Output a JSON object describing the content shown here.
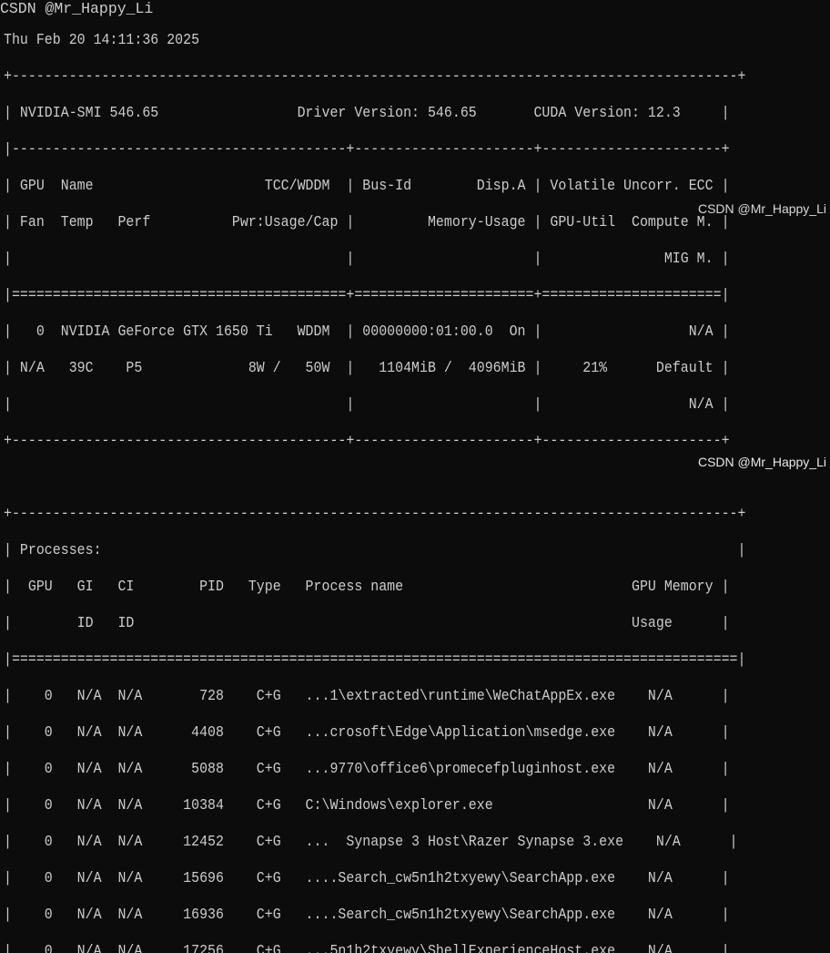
{
  "terminal": {
    "lines": [
      "",
      "Thu Feb 20 14:11:36 2025",
      "+-----------------------------------------------------------------------------------------+",
      "| NVIDIA-SMI 546.65                 Driver Version: 546.65       CUDA Version: 12.3     |",
      "|-----------------------------------------+----------------------+----------------------+",
      "| GPU  Name                     TCC/WDDM  | Bus-Id        Disp.A | Volatile Uncorr. ECC |",
      "| Fan  Temp   Perf          Pwr:Usage/Cap |         Memory-Usage | GPU-Util  Compute M. |",
      "|                                         |                      |               MIG M. |",
      "|=========================================+======================+======================|",
      "|   0  NVIDIA GeForce GTX 1650 Ti   WDDM  | 00000000:01:00.0  On |                  N/A |",
      "| N/A   39C    P5             8W /   50W  |   1104MiB /  4096MiB |     21%      Default |",
      "|                                         |                      |                  N/A |",
      "+-----------------------------------------+----------------------+----------------------+",
      "",
      "+-----------------------------------------------------------------------------------------+",
      "| Processes:                                                                              |",
      "|  GPU   GI   CI        PID   Type   Process name                            GPU Memory |",
      "|        ID   ID                                                             Usage      |",
      "|=========================================================================================|",
      "|    0   N/A  N/A       728    C+G   ...1\\extracted\\runtime\\WeChatAppEx.exe    N/A      |",
      "|    0   N/A  N/A      4408    C+G   ...crosoft\\Edge\\Application\\msedge.exe    N/A      |",
      "|    0   N/A  N/A      5088    C+G   ...9770\\office6\\promecefpluginhost.exe    N/A      |",
      "|    0   N/A  N/A     10384    C+G   C:\\Windows\\explorer.exe                   N/A      |",
      "|    0   N/A  N/A     12452    C+G   ...  Synapse 3 Host\\Razer Synapse 3.exe    N/A      |",
      "|    0   N/A  N/A     15696    C+G   ....Search_cw5n1h2txyewy\\SearchApp.exe    N/A      |",
      "|    0   N/A  N/A     16936    C+G   ....Search_cw5n1h2txyewy\\SearchApp.exe    N/A      |",
      "|    0   N/A  N/A     17256    C+G   ...5n1h2txyewy\\ShellExperienceHost.exe    N/A      |"
    ]
  },
  "watermark": {
    "text": "CSDN @Mr_Happy_Li"
  }
}
